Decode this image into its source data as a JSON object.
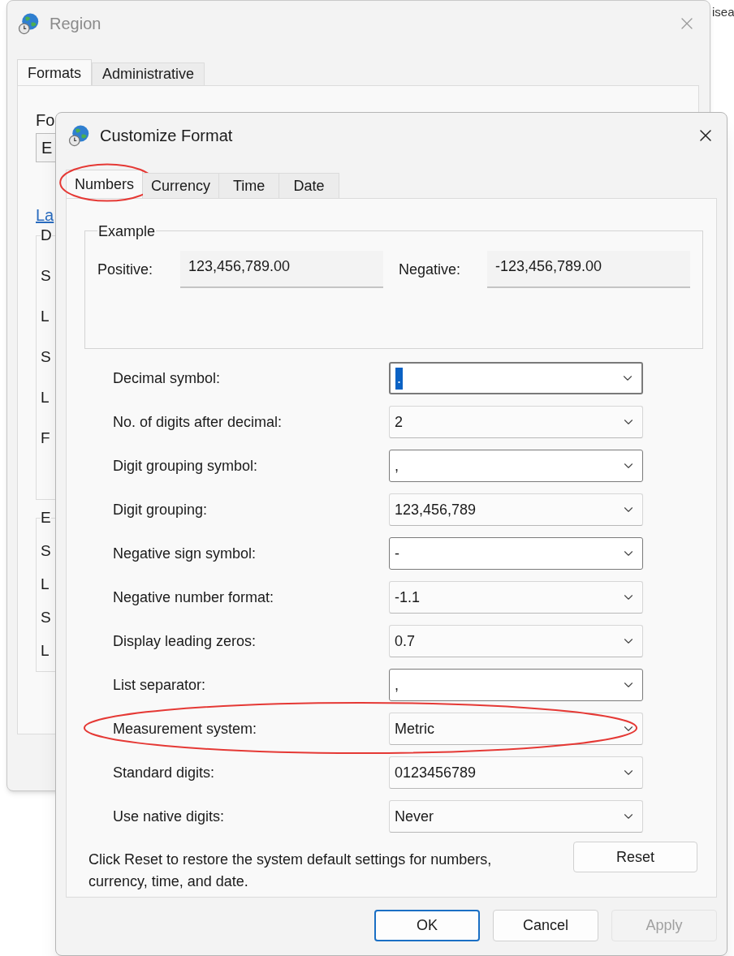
{
  "behind_text": "isea",
  "background_window": {
    "title": "Region",
    "tabs": [
      {
        "label": "Formats",
        "selected": true
      },
      {
        "label": "Administrative",
        "selected": false
      }
    ],
    "format_label": "Fo",
    "format_field": "E",
    "link": "La",
    "groups": [
      {
        "legend": "D",
        "rows": [
          "S",
          "L",
          "S",
          "L",
          "F"
        ]
      },
      {
        "legend": "E",
        "rows": [
          "S",
          "L",
          "S",
          "L"
        ]
      }
    ]
  },
  "dialog": {
    "title": "Customize Format",
    "tabs": [
      {
        "label": "Numbers",
        "selected": true,
        "highlighted": true
      },
      {
        "label": "Currency",
        "selected": false,
        "highlighted": false
      },
      {
        "label": "Time",
        "selected": false,
        "highlighted": false
      },
      {
        "label": "Date",
        "selected": false,
        "highlighted": false
      }
    ],
    "example": {
      "legend": "Example",
      "positive_label": "Positive:",
      "positive_value": "123,456,789.00",
      "negative_label": "Negative:",
      "negative_value": "-123,456,789.00"
    },
    "settings": [
      {
        "label": "Decimal symbol:",
        "value": ".",
        "kind": "editable",
        "focused": true,
        "highlighted": false
      },
      {
        "label": "No. of digits after decimal:",
        "value": "2",
        "kind": "list",
        "focused": false,
        "highlighted": false
      },
      {
        "label": "Digit grouping symbol:",
        "value": ",",
        "kind": "editable",
        "focused": false,
        "highlighted": false
      },
      {
        "label": "Digit grouping:",
        "value": "123,456,789",
        "kind": "list",
        "focused": false,
        "highlighted": false
      },
      {
        "label": "Negative sign symbol:",
        "value": "-",
        "kind": "editable",
        "focused": false,
        "highlighted": false
      },
      {
        "label": "Negative number format:",
        "value": "-1.1",
        "kind": "list",
        "focused": false,
        "highlighted": false
      },
      {
        "label": "Display leading zeros:",
        "value": "0.7",
        "kind": "list",
        "focused": false,
        "highlighted": false
      },
      {
        "label": "List separator:",
        "value": ",",
        "kind": "editable",
        "focused": false,
        "highlighted": false
      },
      {
        "label": "Measurement system:",
        "value": "Metric",
        "kind": "list",
        "focused": false,
        "highlighted": true
      },
      {
        "label": "Standard digits:",
        "value": "0123456789",
        "kind": "list",
        "focused": false,
        "highlighted": false
      },
      {
        "label": "Use native digits:",
        "value": "Never",
        "kind": "list",
        "focused": false,
        "highlighted": false
      }
    ],
    "note": "Click Reset to restore the system default settings for numbers, currency, time, and date.",
    "reset_button": "Reset",
    "buttons": [
      {
        "label": "OK",
        "default": true,
        "disabled": false
      },
      {
        "label": "Cancel",
        "default": false,
        "disabled": false
      },
      {
        "label": "Apply",
        "default": false,
        "disabled": true
      }
    ]
  }
}
